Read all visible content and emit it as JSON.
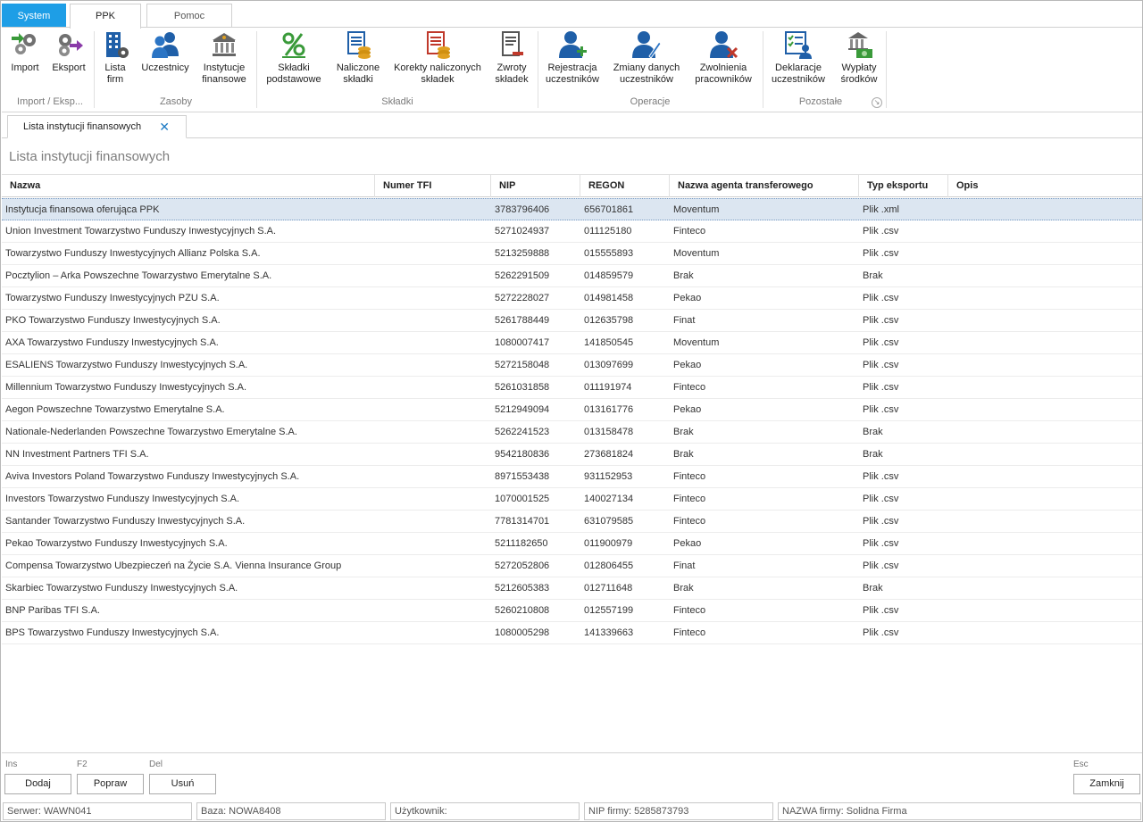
{
  "top_tabs": {
    "system": "System",
    "ppk": "PPK",
    "pomoc": "Pomoc"
  },
  "ribbon": {
    "import": "Import",
    "eksport": "Eksport",
    "lista_firm_1": "Lista",
    "lista_firm_2": "firm",
    "uczestnicy": "Uczestnicy",
    "instytucje_1": "Instytucje",
    "instytucje_2": "finansowe",
    "skladki_pod_1": "Składki",
    "skladki_pod_2": "podstawowe",
    "naliczone_1": "Naliczone",
    "naliczone_2": "składki",
    "korekty_1": "Korekty naliczonych",
    "korekty_2": "składek",
    "zwroty_1": "Zwroty",
    "zwroty_2": "składek",
    "rejestracja_1": "Rejestracja",
    "rejestracja_2": "uczestników",
    "zmiany_1": "Zmiany danych",
    "zmiany_2": "uczestników",
    "zwolnienia_1": "Zwolnienia",
    "zwolnienia_2": "pracowników",
    "deklaracje_1": "Deklaracje",
    "deklaracje_2": "uczestników",
    "wyplaty_1": "Wypłaty",
    "wyplaty_2": "środków",
    "groups": {
      "import_eksp": "Import / Eksp...",
      "zasoby": "Zasoby",
      "skladki": "Składki",
      "operacje": "Operacje",
      "pozostale": "Pozostałe"
    }
  },
  "doc_tab": {
    "label": "Lista instytucji finansowych",
    "close": "✕"
  },
  "page_title": "Lista instytucji finansowych",
  "grid": {
    "headers": {
      "nazwa": "Nazwa",
      "numer_tfi": "Numer TFI",
      "nip": "NIP",
      "regon": "REGON",
      "agent": "Nazwa agenta transferowego",
      "typ": "Typ eksportu",
      "opis": "Opis"
    },
    "rows": [
      {
        "nazwa": "Instytucja finansowa oferująca PPK",
        "tfi": "",
        "nip": "3783796406",
        "regon": "656701861",
        "agent": "Moventum",
        "typ": "Plik .xml",
        "opis": ""
      },
      {
        "nazwa": "Union Investment Towarzystwo Funduszy Inwestycyjnych S.A.",
        "tfi": "",
        "nip": "5271024937",
        "regon": "011125180",
        "agent": "Finteco",
        "typ": "Plik .csv",
        "opis": ""
      },
      {
        "nazwa": "Towarzystwo Funduszy Inwestycyjnych Allianz Polska S.A.",
        "tfi": "",
        "nip": "5213259888",
        "regon": "015555893",
        "agent": "Moventum",
        "typ": "Plik .csv",
        "opis": ""
      },
      {
        "nazwa": "Pocztylion – Arka Powszechne Towarzystwo Emerytalne S.A.",
        "tfi": "",
        "nip": "5262291509",
        "regon": "014859579",
        "agent": "Brak",
        "typ": "Brak",
        "opis": ""
      },
      {
        "nazwa": "Towarzystwo Funduszy Inwestycyjnych PZU S.A.",
        "tfi": "",
        "nip": "5272228027",
        "regon": "014981458",
        "agent": "Pekao",
        "typ": "Plik .csv",
        "opis": ""
      },
      {
        "nazwa": "PKO Towarzystwo Funduszy Inwestycyjnych S.A.",
        "tfi": "",
        "nip": "5261788449",
        "regon": "012635798",
        "agent": "Finat",
        "typ": "Plik .csv",
        "opis": ""
      },
      {
        "nazwa": "AXA Towarzystwo Funduszy Inwestycyjnych S.A.",
        "tfi": "",
        "nip": "1080007417",
        "regon": "141850545",
        "agent": "Moventum",
        "typ": "Plik .csv",
        "opis": ""
      },
      {
        "nazwa": "ESALIENS Towarzystwo Funduszy Inwestycyjnych S.A.",
        "tfi": "",
        "nip": "5272158048",
        "regon": "013097699",
        "agent": "Pekao",
        "typ": "Plik .csv",
        "opis": ""
      },
      {
        "nazwa": "Millennium Towarzystwo Funduszy Inwestycyjnych S.A.",
        "tfi": "",
        "nip": "5261031858",
        "regon": "011191974",
        "agent": "Finteco",
        "typ": "Plik .csv",
        "opis": ""
      },
      {
        "nazwa": "Aegon Powszechne Towarzystwo Emerytalne S.A.",
        "tfi": "",
        "nip": "5212949094",
        "regon": "013161776",
        "agent": "Pekao",
        "typ": "Plik .csv",
        "opis": ""
      },
      {
        "nazwa": "Nationale-Nederlanden Powszechne Towarzystwo Emerytalne S.A.",
        "tfi": "",
        "nip": "5262241523",
        "regon": "013158478",
        "agent": "Brak",
        "typ": "Brak",
        "opis": ""
      },
      {
        "nazwa": "NN Investment Partners TFI S.A.",
        "tfi": "",
        "nip": "9542180836",
        "regon": "273681824",
        "agent": "Brak",
        "typ": "Brak",
        "opis": ""
      },
      {
        "nazwa": "Aviva Investors Poland Towarzystwo Funduszy Inwestycyjnych S.A.",
        "tfi": "",
        "nip": "8971553438",
        "regon": "931152953",
        "agent": "Finteco",
        "typ": "Plik .csv",
        "opis": ""
      },
      {
        "nazwa": "Investors Towarzystwo Funduszy Inwestycyjnych S.A.",
        "tfi": "",
        "nip": "1070001525",
        "regon": "140027134",
        "agent": "Finteco",
        "typ": "Plik .csv",
        "opis": ""
      },
      {
        "nazwa": "Santander Towarzystwo Funduszy Inwestycyjnych S.A.",
        "tfi": "",
        "nip": "7781314701",
        "regon": "631079585",
        "agent": "Finteco",
        "typ": "Plik .csv",
        "opis": ""
      },
      {
        "nazwa": "Pekao Towarzystwo Funduszy Inwestycyjnych S.A.",
        "tfi": "",
        "nip": "5211182650",
        "regon": "011900979",
        "agent": "Pekao",
        "typ": "Plik .csv",
        "opis": ""
      },
      {
        "nazwa": "Compensa Towarzystwo Ubezpieczeń na Życie S.A. Vienna Insurance Group",
        "tfi": "",
        "nip": "5272052806",
        "regon": "012806455",
        "agent": "Finat",
        "typ": "Plik .csv",
        "opis": ""
      },
      {
        "nazwa": "Skarbiec Towarzystwo Funduszy Inwestycyjnych S.A.",
        "tfi": "",
        "nip": "5212605383",
        "regon": "012711648",
        "agent": "Brak",
        "typ": "Brak",
        "opis": ""
      },
      {
        "nazwa": "BNP Paribas TFI S.A.",
        "tfi": "",
        "nip": "5260210808",
        "regon": "012557199",
        "agent": "Finteco",
        "typ": "Plik .csv",
        "opis": ""
      },
      {
        "nazwa": "BPS Towarzystwo Funduszy Inwestycyjnych S.A.",
        "tfi": "",
        "nip": "1080005298",
        "regon": "141339663",
        "agent": "Finteco",
        "typ": "Plik .csv",
        "opis": ""
      }
    ]
  },
  "bottom": {
    "hotkey_ins": "Ins",
    "hotkey_f2": "F2",
    "hotkey_del": "Del",
    "hotkey_esc": "Esc",
    "dodaj": "Dodaj",
    "popraw": "Popraw",
    "usun": "Usuń",
    "zamknij": "Zamknij"
  },
  "status": {
    "serwer": "Serwer: WAWN041",
    "baza": "Baza: NOWA8408",
    "uzytkownik": "Użytkownik:",
    "nip_firmy": "NIP firmy: 5285873793",
    "nazwa_firmy": "NAZWA firmy: Solidna Firma"
  },
  "colors": {
    "accent": "#1e9ee6",
    "icon_blue": "#1f5fa8",
    "selection": "#dce6f1"
  }
}
